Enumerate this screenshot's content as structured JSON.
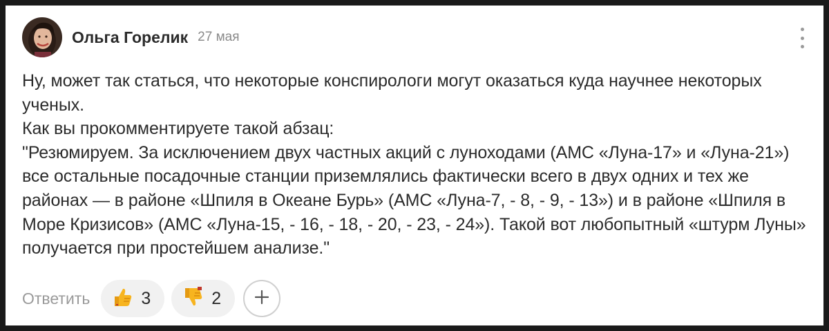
{
  "comment": {
    "author": "Ольга Горелик",
    "date": "27 мая",
    "paragraphs": [
      "Ну, может так статься, что некоторые конспирологи могут оказаться куда научнее некоторых ученых.",
      "Как вы прокомментируете такой абзац:",
      "\"Резюмируем. За исключением двух частных акций с луноходами (АМС «Луна-17» и «Луна-21») все остальные посадочные станции приземлялись фактически всего в двух одних и тех же районах — в районе «Шпиля в Океане Бурь» (АМС «Луна-7, - 8, - 9, - 13») и в районе «Шпиля в Море Кризисов» (АМС «Луна-15, - 16, - 18, - 20, - 23, - 24»). Такой вот любопытный «штурм Луны» получается при простейшем анализе.\""
    ]
  },
  "actions": {
    "reply_label": "Ответить",
    "likes": "3",
    "dislikes": "2"
  },
  "icons": {
    "menu": "more-vertical-icon",
    "like": "thumbs-up-emoji-icon",
    "dislike": "thumbs-down-emoji-icon",
    "add": "plus-icon"
  },
  "colors": {
    "pill_bg": "#f1f1f1",
    "emoji_yellow": "#f7b41f",
    "muted_text": "#9a9a9a"
  }
}
